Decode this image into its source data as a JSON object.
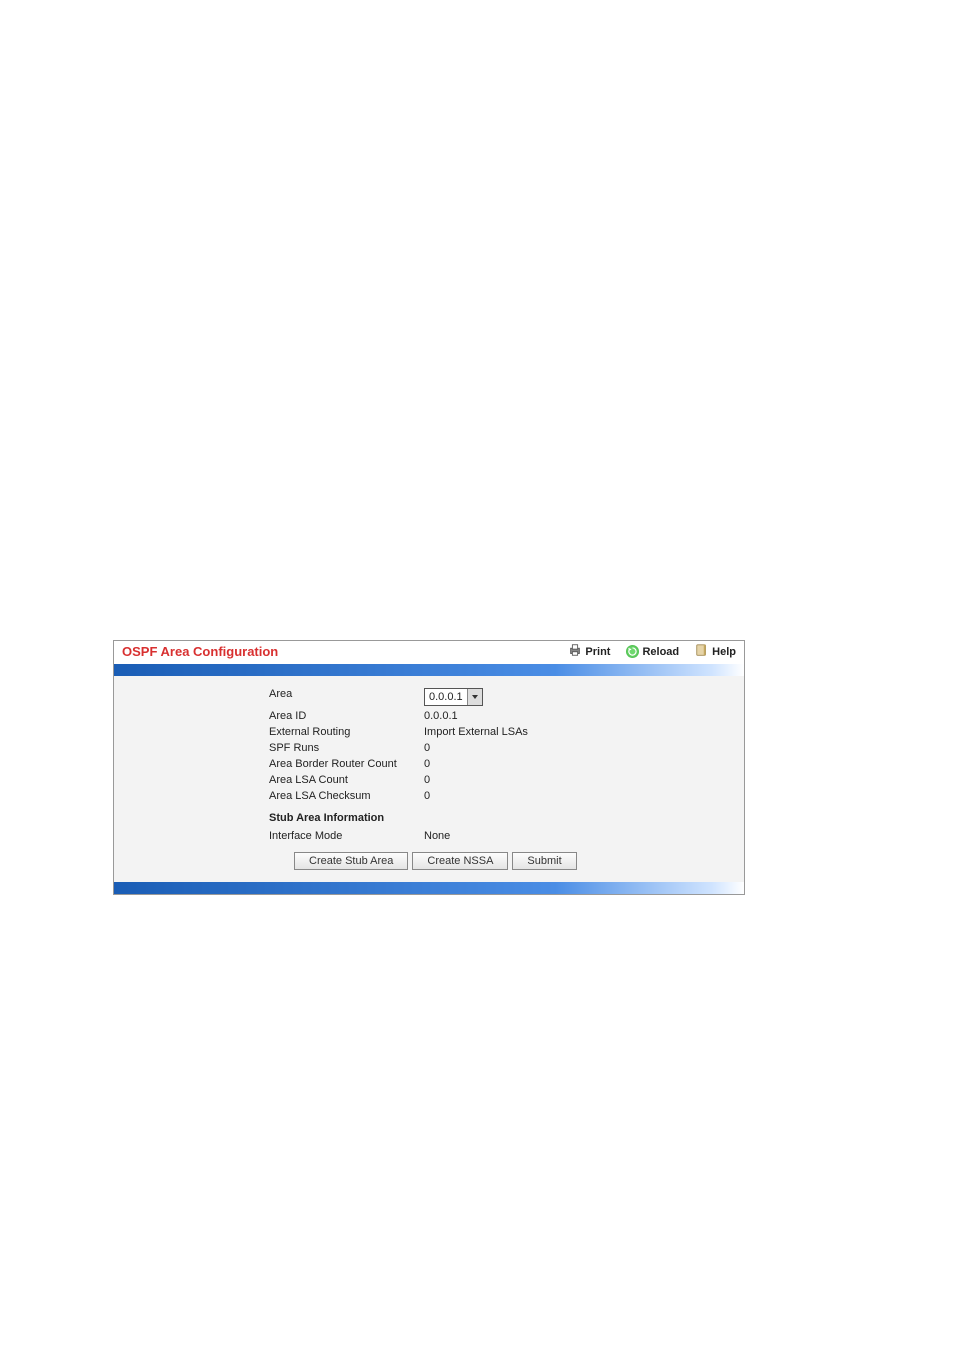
{
  "header": {
    "title": "OSPF Area Configuration",
    "print": "Print",
    "reload": "Reload",
    "help": "Help"
  },
  "area_select": {
    "label": "Area",
    "selected": "0.0.0.1"
  },
  "rows": [
    {
      "label": "Area ID",
      "value": "0.0.0.1"
    },
    {
      "label": "External Routing",
      "value": "Import External LSAs"
    },
    {
      "label": "SPF Runs",
      "value": "0"
    },
    {
      "label": "Area Border Router Count",
      "value": "0"
    },
    {
      "label": "Area LSA Count",
      "value": "0"
    },
    {
      "label": "Area LSA Checksum",
      "value": "0"
    }
  ],
  "stub_section": "Stub Area Information",
  "stub_row": {
    "label": "Interface Mode",
    "value": "None"
  },
  "buttons": {
    "stub": "Create Stub Area",
    "nssa": "Create NSSA",
    "submit": "Submit"
  }
}
